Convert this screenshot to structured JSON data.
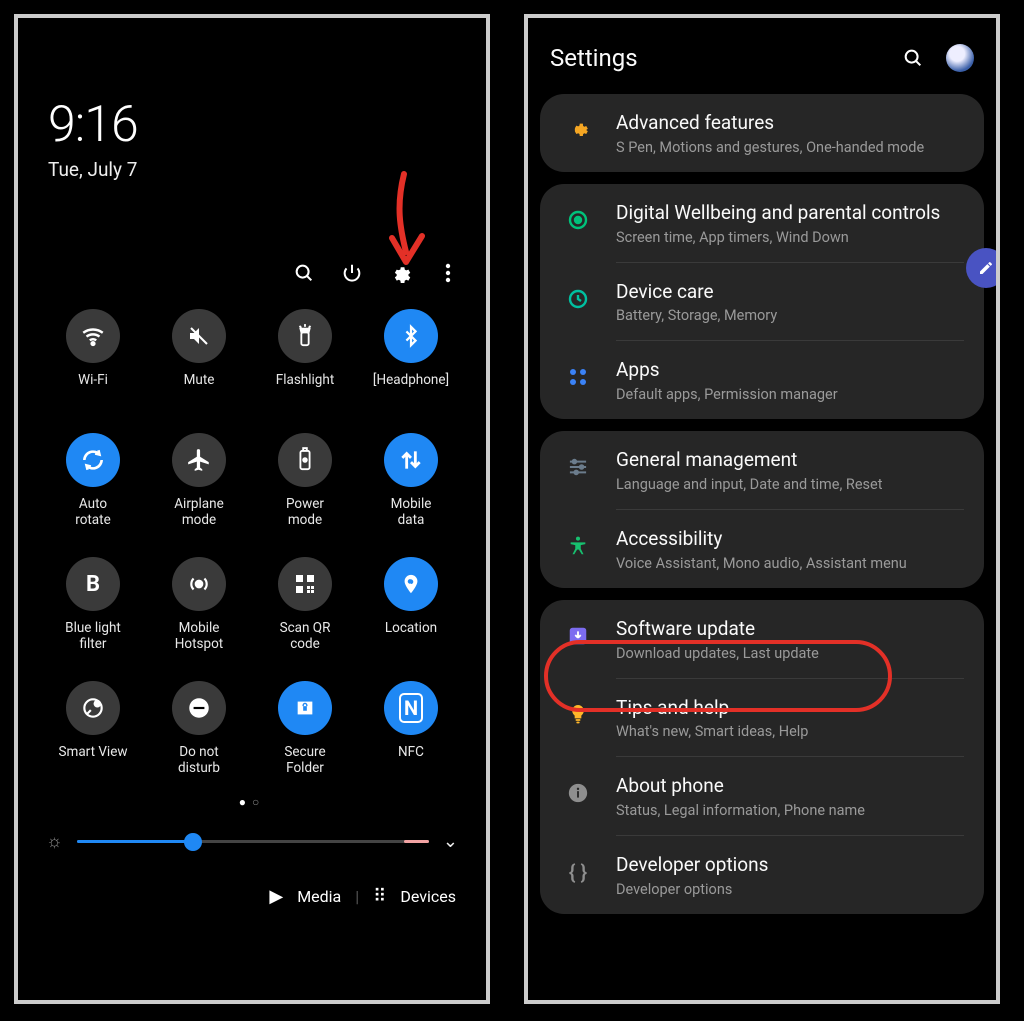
{
  "left": {
    "time": "9:16",
    "date": "Tue, July 7",
    "iconbar": {
      "search": "search-icon",
      "power": "power-icon",
      "settings": "gear-icon",
      "more": "more-icon"
    },
    "tiles": [
      {
        "id": "wifi",
        "label": "Wi-Fi",
        "on": false
      },
      {
        "id": "mute",
        "label": "Mute",
        "on": false
      },
      {
        "id": "flashlight",
        "label": "Flashlight",
        "on": false
      },
      {
        "id": "bluetooth",
        "label": "[Headphone]",
        "on": true
      },
      {
        "id": "autorotate",
        "label": "Auto\nrotate",
        "on": true
      },
      {
        "id": "airplane",
        "label": "Airplane\nmode",
        "on": false
      },
      {
        "id": "powermode",
        "label": "Power\nmode",
        "on": false
      },
      {
        "id": "mobiledata",
        "label": "Mobile\ndata",
        "on": true
      },
      {
        "id": "bluelight",
        "label": "Blue light\nfilter",
        "on": false
      },
      {
        "id": "hotspot",
        "label": "Mobile\nHotspot",
        "on": false
      },
      {
        "id": "qr",
        "label": "Scan QR\ncode",
        "on": false
      },
      {
        "id": "location",
        "label": "Location",
        "on": true
      },
      {
        "id": "smartview",
        "label": "Smart View",
        "on": false
      },
      {
        "id": "dnd",
        "label": "Do not\ndisturb",
        "on": false
      },
      {
        "id": "secure",
        "label": "Secure\nFolder",
        "on": true
      },
      {
        "id": "nfc",
        "label": "NFC",
        "on": true
      }
    ],
    "footer": {
      "media": "Media",
      "devices": "Devices"
    }
  },
  "right": {
    "title": "Settings",
    "groups": [
      {
        "items": [
          {
            "id": "advanced",
            "title": "Advanced features",
            "sub": "S Pen, Motions and gestures, One-handed mode",
            "iconColor": "#f5a623"
          }
        ]
      },
      {
        "items": [
          {
            "id": "wellbeing",
            "title": "Digital Wellbeing and parental controls",
            "sub": "Screen time, App timers, Wind Down",
            "iconColor": "#00c27a"
          },
          {
            "id": "devicecare",
            "title": "Device care",
            "sub": "Battery, Storage, Memory",
            "iconColor": "#00bfa0"
          },
          {
            "id": "apps",
            "title": "Apps",
            "sub": "Default apps, Permission manager",
            "iconColor": "#3b82f6"
          }
        ]
      },
      {
        "items": [
          {
            "id": "general",
            "title": "General management",
            "sub": "Language and input, Date and time, Reset",
            "iconColor": "#6b7c8c"
          },
          {
            "id": "a11y",
            "title": "Accessibility",
            "sub": "Voice Assistant, Mono audio, Assistant menu",
            "iconColor": "#17c06f"
          }
        ]
      },
      {
        "items": [
          {
            "id": "software",
            "title": "Software update",
            "sub": "Download updates, Last update",
            "iconColor": "#7c6cf0"
          },
          {
            "id": "tips",
            "title": "Tips and help",
            "sub": "What's new, Smart ideas, Help",
            "iconColor": "#ffb629"
          },
          {
            "id": "about",
            "title": "About phone",
            "sub": "Status, Legal information, Phone name",
            "iconColor": "#8e8e8e"
          },
          {
            "id": "dev",
            "title": "Developer options",
            "sub": "Developer options",
            "iconColor": "#8e8e8e"
          }
        ]
      }
    ]
  }
}
